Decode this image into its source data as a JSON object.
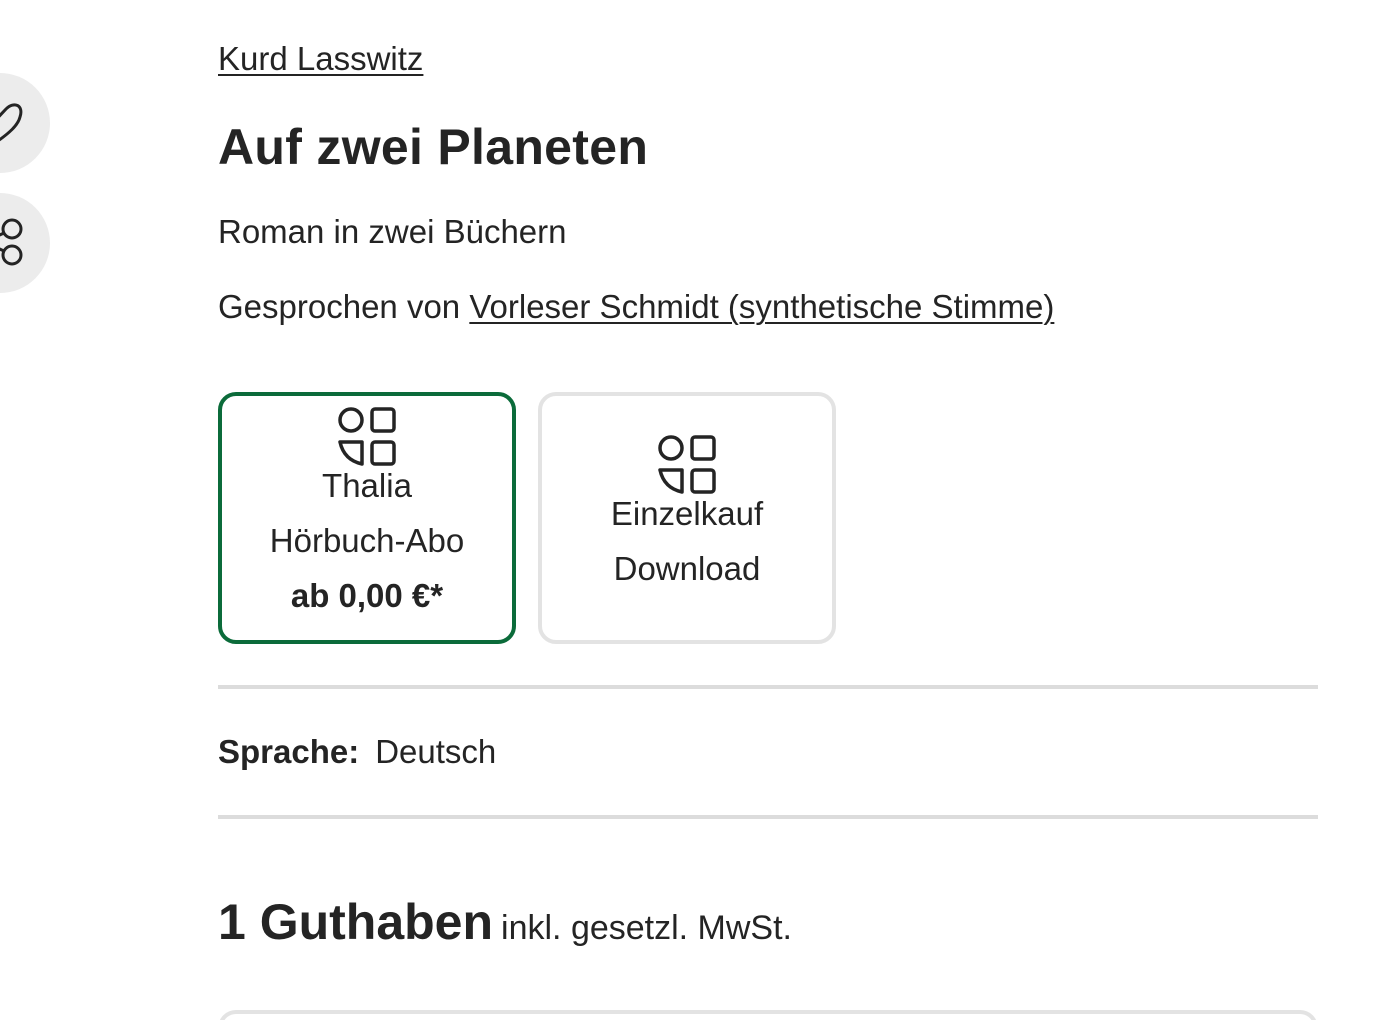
{
  "sidebar_actions": {
    "favorite_icon": "heart-icon",
    "share_icon": "share-icon"
  },
  "product": {
    "author": "Kurd Lasswitz",
    "title": "Auf zwei Planeten",
    "subtitle": "Roman in zwei Büchern",
    "narrator_prefix": "Gesprochen von ",
    "narrator_name": "Vorleser Schmidt (synthetische Stimme)"
  },
  "formats": [
    {
      "icon": "apps-grid-icon",
      "line1": "Thalia",
      "line2": "Hörbuch-Abo",
      "price": "ab 0,00 €*",
      "selected": true
    },
    {
      "icon": "apps-grid-icon",
      "line1": "Einzelkauf",
      "line2": "Download",
      "selected": false
    }
  ],
  "details": {
    "language_label": "Sprache:",
    "language_value": "Deutsch"
  },
  "price": {
    "amount": "1 Guthaben",
    "note": "inkl. gesetzl. MwSt."
  },
  "colors": {
    "selected_border": "#0b6b3a",
    "text": "#242424",
    "divider": "#dcdcdc",
    "fab_bg": "#ececec"
  }
}
